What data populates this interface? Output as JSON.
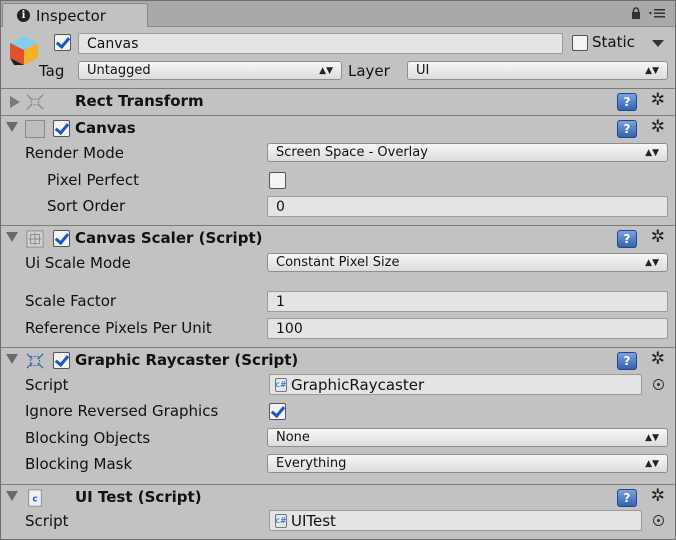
{
  "tab": {
    "title": "Inspector",
    "info_icon": "info-icon",
    "lock_icon": "lock-icon",
    "menu_icon": "tab-menu-icon"
  },
  "game_object": {
    "active": true,
    "name": "Canvas",
    "static_label": "Static",
    "static": false,
    "tag_label": "Tag",
    "tag_value": "Untagged",
    "layer_label": "Layer",
    "layer_value": "UI"
  },
  "components": {
    "rect_transform": {
      "title": "Rect Transform",
      "expanded": false
    },
    "canvas": {
      "title": "Canvas",
      "enabled": true,
      "render_mode_label": "Render Mode",
      "render_mode_value": "Screen Space - Overlay",
      "pixel_perfect_label": "Pixel Perfect",
      "pixel_perfect": false,
      "sort_order_label": "Sort Order",
      "sort_order_value": "0"
    },
    "canvas_scaler": {
      "title": "Canvas Scaler (Script)",
      "enabled": true,
      "ui_scale_mode_label": "Ui Scale Mode",
      "ui_scale_mode_value": "Constant Pixel Size",
      "scale_factor_label": "Scale Factor",
      "scale_factor_value": "1",
      "ref_ppu_label": "Reference Pixels Per Unit",
      "ref_ppu_value": "100"
    },
    "graphic_raycaster": {
      "title": "Graphic Raycaster (Script)",
      "enabled": true,
      "script_label": "Script",
      "script_value": "GraphicRaycaster",
      "ignore_reversed_label": "Ignore Reversed Graphics",
      "ignore_reversed": true,
      "blocking_objects_label": "Blocking Objects",
      "blocking_objects_value": "None",
      "blocking_mask_label": "Blocking Mask",
      "blocking_mask_value": "Everything"
    },
    "ui_test": {
      "title": "UI Test (Script)",
      "script_label": "Script",
      "script_value": "UITest"
    }
  },
  "icons": {
    "help": "help-book-icon",
    "settings": "gear-icon"
  },
  "colors": {
    "panel_bg": "#c2c2c2",
    "checkmark": "#1b56c8",
    "help_icon": "#3562b0"
  }
}
